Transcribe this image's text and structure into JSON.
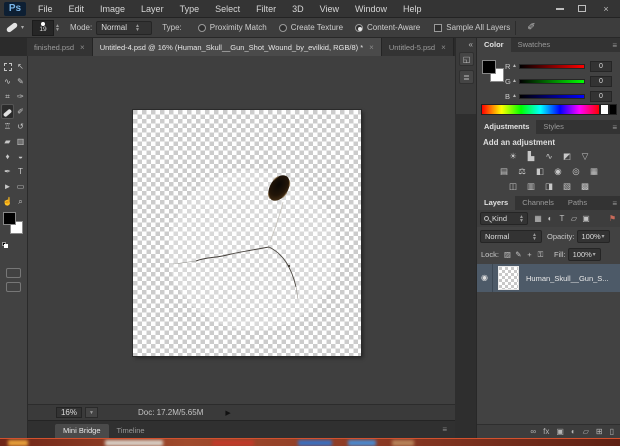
{
  "window": {
    "minimize": "minimize",
    "restore": "restore",
    "close": "×"
  },
  "menu": {
    "logo": "Ps",
    "items": [
      "File",
      "Edit",
      "Image",
      "Layer",
      "Type",
      "Select",
      "Filter",
      "3D",
      "View",
      "Window",
      "Help"
    ]
  },
  "options": {
    "brush_size": "19",
    "mode_label": "Mode:",
    "mode_value": "Normal",
    "type_label": "Type:",
    "radios": [
      {
        "label": "Proximity Match",
        "selected": false
      },
      {
        "label": "Create Texture",
        "selected": false
      },
      {
        "label": "Content-Aware",
        "selected": true
      }
    ],
    "checkbox_label": "Sample All Layers"
  },
  "tabs": [
    {
      "label": "finished.psd",
      "close": "×",
      "active": false
    },
    {
      "label": "Untitled-4.psd @ 16% (Human_Skull__Gun_Shot_Wound_by_evilkid, RGB/8) *",
      "close": "×",
      "active": true
    },
    {
      "label": "Untitled-5.psd",
      "close": "×",
      "active": false
    }
  ],
  "toolbox": {
    "columns": [
      {
        "tools": [
          {
            "name": "rectangular-marquee-tool",
            "glyph": "[dash]"
          },
          {
            "name": "lasso-tool",
            "glyph": "∿"
          },
          {
            "name": "crop-tool",
            "glyph": "⌗"
          },
          {
            "name": "spot-healing-brush-tool",
            "glyph": "[bandaid]",
            "selected": true
          },
          {
            "name": "clone-stamp-tool",
            "glyph": "♖"
          },
          {
            "name": "eraser-tool",
            "glyph": "▰"
          },
          {
            "name": "blur-tool",
            "glyph": "♦"
          },
          {
            "name": "pen-tool",
            "glyph": "✒"
          },
          {
            "name": "path-selection-tool",
            "glyph": "►"
          },
          {
            "name": "hand-tool",
            "glyph": "☝"
          }
        ]
      },
      {
        "tools": [
          {
            "name": "move-tool",
            "glyph": "↖"
          },
          {
            "name": "quick-selection-tool",
            "glyph": "✎"
          },
          {
            "name": "eyedropper-tool",
            "glyph": "✑"
          },
          {
            "name": "brush-tool",
            "glyph": "✐"
          },
          {
            "name": "history-brush-tool",
            "glyph": "↺"
          },
          {
            "name": "gradient-tool",
            "glyph": "▥"
          },
          {
            "name": "dodge-tool",
            "glyph": "◒"
          },
          {
            "name": "type-tool",
            "glyph": "T"
          },
          {
            "name": "rectangle-tool",
            "glyph": "▭"
          },
          {
            "name": "zoom-tool",
            "glyph": "⌕"
          }
        ]
      }
    ],
    "foreground_color": "#000000",
    "background_color": "#ffffff"
  },
  "collapsed_dock": {
    "expand": "«",
    "icons": [
      {
        "name": "history-panel-icon",
        "glyph": "◱"
      },
      {
        "name": "properties-panel-icon",
        "glyph": "≣"
      }
    ]
  },
  "color_panel": {
    "tabs": [
      {
        "label": "Color",
        "active": true
      },
      {
        "label": "Swatches",
        "active": false
      }
    ],
    "menu_icon": "≡",
    "channels": [
      {
        "label": "R",
        "value": "0"
      },
      {
        "label": "G",
        "value": "0"
      },
      {
        "label": "B",
        "value": "0"
      }
    ]
  },
  "adjustments_panel": {
    "tabs": [
      {
        "label": "Adjustments",
        "active": true
      },
      {
        "label": "Styles",
        "active": false
      }
    ],
    "menu_icon": "≡",
    "hint": "Add an adjustment",
    "rows": [
      [
        {
          "name": "brightness-contrast-icon",
          "glyph": "☀"
        },
        {
          "name": "levels-icon",
          "glyph": "▙"
        },
        {
          "name": "curves-icon",
          "glyph": "∿"
        },
        {
          "name": "exposure-icon",
          "glyph": "◩"
        },
        {
          "name": "vibrance-icon",
          "glyph": "▽"
        }
      ],
      [
        {
          "name": "hue-saturation-icon",
          "glyph": "▤"
        },
        {
          "name": "color-balance-icon",
          "glyph": "⚖"
        },
        {
          "name": "black-white-icon",
          "glyph": "◧"
        },
        {
          "name": "photo-filter-icon",
          "glyph": "◉"
        },
        {
          "name": "channel-mixer-icon",
          "glyph": "◎"
        },
        {
          "name": "color-lookup-icon",
          "glyph": "▦"
        }
      ],
      [
        {
          "name": "invert-icon",
          "glyph": "◫"
        },
        {
          "name": "posterize-icon",
          "glyph": "▥"
        },
        {
          "name": "threshold-icon",
          "glyph": "◨"
        },
        {
          "name": "gradient-map-icon",
          "glyph": "▧"
        },
        {
          "name": "selective-color-icon",
          "glyph": "▩"
        }
      ]
    ]
  },
  "layers_panel": {
    "tabs": [
      {
        "label": "Layers",
        "active": true
      },
      {
        "label": "Channels",
        "active": false
      },
      {
        "label": "Paths",
        "active": false
      }
    ],
    "menu_icon": "≡",
    "kind_label": "Kind",
    "filter_icons": [
      {
        "name": "filter-pixel-layers-icon",
        "glyph": "▦"
      },
      {
        "name": "filter-adjustment-layers-icon",
        "glyph": "◐"
      },
      {
        "name": "filter-type-layers-icon",
        "glyph": "T"
      },
      {
        "name": "filter-shape-layers-icon",
        "glyph": "▱"
      },
      {
        "name": "filter-smart-objects-icon",
        "glyph": "▣"
      }
    ],
    "filter_toggle": "⚑",
    "blend_mode": "Normal",
    "opacity_label": "Opacity:",
    "opacity_value": "100%",
    "lock_label": "Lock:",
    "lock_icons": [
      {
        "name": "lock-transparent-pixels-icon",
        "glyph": "▨"
      },
      {
        "name": "lock-image-pixels-icon",
        "glyph": "✎"
      },
      {
        "name": "lock-position-icon",
        "glyph": "+"
      },
      {
        "name": "lock-all-icon",
        "glyph": "⚿"
      }
    ],
    "fill_label": "Fill:",
    "fill_value": "100%",
    "layer": {
      "name": "Human_Skull__Gun_S...",
      "visible": true
    },
    "eye_icon": "◉",
    "bottom_icons": [
      {
        "name": "link-layers-icon",
        "glyph": "∞"
      },
      {
        "name": "layer-effects-icon",
        "glyph": "fx"
      },
      {
        "name": "add-layer-mask-icon",
        "glyph": "▣"
      },
      {
        "name": "new-adjustment-layer-icon",
        "glyph": "◐"
      },
      {
        "name": "new-group-icon",
        "glyph": "▱"
      },
      {
        "name": "new-layer-icon",
        "glyph": "⊞"
      },
      {
        "name": "delete-layer-icon",
        "glyph": "▯"
      }
    ]
  },
  "statusbar": {
    "zoom": "16%",
    "doc": "Doc: 17.2M/5.65M",
    "arrow": "▶"
  },
  "bottom_tabs": [
    {
      "label": "Mini Bridge",
      "active": true
    },
    {
      "label": "Timeline",
      "active": false
    }
  ],
  "colors": {
    "selected_layer": "#4d5a68",
    "panel_bg": "#424242",
    "taskbar": "#8c3a24",
    "logo_blue": "#7ab6e8"
  }
}
